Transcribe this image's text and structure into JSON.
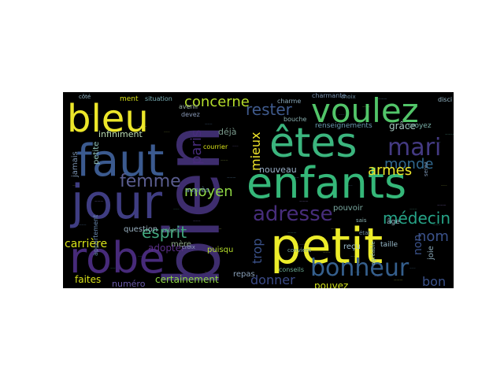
{
  "word_cloud": {
    "words": [
      {
        "text": "bien",
        "color": "#3e2d6e"
      },
      {
        "text": "petit",
        "color": "#ecec2a"
      },
      {
        "text": "enfants",
        "color": "#35b779"
      },
      {
        "text": "êtes",
        "color": "#3bb57e"
      },
      {
        "text": "voulez",
        "color": "#52c569"
      },
      {
        "text": "jour",
        "color": "#3f3d82"
      },
      {
        "text": "faut",
        "color": "#3b5a8f"
      },
      {
        "text": "robe",
        "color": "#472a7a"
      },
      {
        "text": "bleu",
        "color": "#ece62a"
      },
      {
        "text": "mari",
        "color": "#443a83"
      },
      {
        "text": "bonheur",
        "color": "#355f8d"
      },
      {
        "text": "adresse",
        "color": "#472d7b"
      },
      {
        "text": "femme",
        "color": "#5a5d8f"
      },
      {
        "text": "moyen",
        "color": "#8fd744"
      },
      {
        "text": "esprit",
        "color": "#42a87e"
      },
      {
        "text": "concerne",
        "color": "#b5de2b"
      },
      {
        "text": "rester",
        "color": "#3f5a8c"
      },
      {
        "text": "paris",
        "color": "#472c7a"
      },
      {
        "text": "mieux",
        "color": "#f0e52a"
      },
      {
        "text": "monde",
        "color": "#31688e"
      },
      {
        "text": "armes",
        "color": "#ece62a"
      },
      {
        "text": "médecin",
        "color": "#26a387"
      },
      {
        "text": "nom",
        "color": "#3b528b"
      },
      {
        "text": "non",
        "color": "#3b528b"
      },
      {
        "text": "bon",
        "color": "#3b528b"
      },
      {
        "text": "trop",
        "color": "#3b528b"
      },
      {
        "text": "donner",
        "color": "#3b4a86"
      },
      {
        "text": "pouvez",
        "color": "#d2e21b"
      },
      {
        "text": "adopter",
        "color": "#5a2e86"
      },
      {
        "text": "carrière",
        "color": "#d8e219"
      },
      {
        "text": "faites",
        "color": "#d8e219"
      },
      {
        "text": "certainement",
        "color": "#8fd744"
      },
      {
        "text": "déjà",
        "color": "#7a9a8c"
      },
      {
        "text": "nouveau",
        "color": "#9bb0c8"
      },
      {
        "text": "grâce",
        "color": "#a6c8c0"
      },
      {
        "text": "infiniment",
        "color": "#b8d8b0"
      },
      {
        "text": "numéro",
        "color": "#6a5aa8"
      },
      {
        "text": "question",
        "color": "#9ab0c0"
      },
      {
        "text": "mère",
        "color": "#8fa88a"
      },
      {
        "text": "repas",
        "color": "#8aa0b8"
      },
      {
        "text": "puisqu",
        "color": "#b5de2b"
      },
      {
        "text": "petite",
        "color": "#8fc0b8"
      },
      {
        "text": "jamais",
        "color": "#7a92b0"
      },
      {
        "text": "auprès",
        "color": "#6a8ab0"
      },
      {
        "text": "pouvoir",
        "color": "#7aa8a0"
      },
      {
        "text": "reçu",
        "color": "#9abccc"
      },
      {
        "text": "joie",
        "color": "#8aa8b8"
      },
      {
        "text": "âge",
        "color": "#9abccc"
      },
      {
        "text": "taille",
        "color": "#9abccc"
      },
      {
        "text": "conseils",
        "color": "#6aa890"
      },
      {
        "text": "renseignements",
        "color": "#6a9ab0"
      },
      {
        "text": "croyez",
        "color": "#7ab0a8"
      },
      {
        "text": "charme",
        "color": "#8aa8b8"
      },
      {
        "text": "charmante",
        "color": "#7a92b0"
      },
      {
        "text": "choix",
        "color": "#6a8aa0"
      },
      {
        "text": "bouche",
        "color": "#8ab0b0"
      },
      {
        "text": "courrier",
        "color": "#d8e219"
      },
      {
        "text": "créer",
        "color": "#6aa890"
      },
      {
        "text": "avenir",
        "color": "#9ab0a0"
      },
      {
        "text": "devez",
        "color": "#8a9ab8"
      },
      {
        "text": "situation",
        "color": "#7ab0b8"
      },
      {
        "text": "ment",
        "color": "#d8e219"
      },
      {
        "text": "côté",
        "color": "#9abccc"
      },
      {
        "text": "disci",
        "color": "#9abccc"
      },
      {
        "text": "serez",
        "color": "#7a92b0"
      },
      {
        "text": "état",
        "color": "#6a8aa0"
      },
      {
        "text": "sais",
        "color": "#8ab0b0"
      },
      {
        "text": "convient",
        "color": "#7aa8a0"
      },
      {
        "text": "agréable",
        "color": "#8ab0b0"
      },
      {
        "text": "croix",
        "color": "#8a9ab8"
      },
      {
        "text": "appartement",
        "color": "#6a8ab0"
      }
    ]
  }
}
